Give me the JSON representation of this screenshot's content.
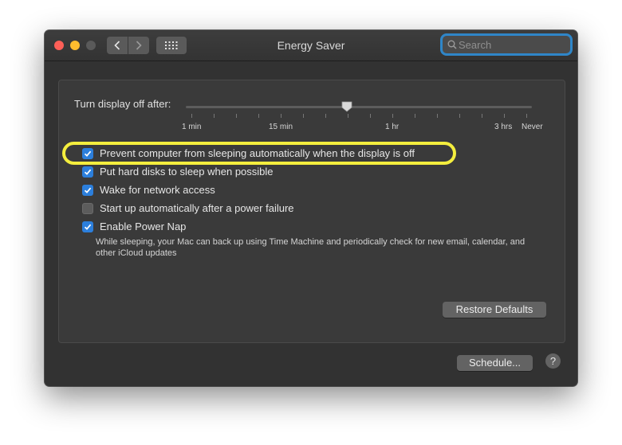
{
  "window": {
    "title": "Energy Saver"
  },
  "search": {
    "placeholder": "Search"
  },
  "slider": {
    "label": "Turn display off after:",
    "tick_labels": [
      "1 min",
      "15 min",
      "1 hr",
      "3 hrs",
      "Never"
    ],
    "value": "1 hr"
  },
  "options": [
    {
      "label": "Prevent computer from sleeping automatically when the display is off",
      "checked": true,
      "highlighted": true
    },
    {
      "label": "Put hard disks to sleep when possible",
      "checked": true
    },
    {
      "label": "Wake for network access",
      "checked": true
    },
    {
      "label": "Start up automatically after a power failure",
      "checked": false
    },
    {
      "label": "Enable Power Nap",
      "checked": true,
      "description": "While sleeping, your Mac can back up using Time Machine and periodically check for new email, calendar, and other iCloud updates"
    }
  ],
  "buttons": {
    "restore": "Restore Defaults",
    "schedule": "Schedule...",
    "help": "?"
  },
  "colors": {
    "accent": "#2c7fdc",
    "highlight": "#f4ee3e"
  },
  "icons": {
    "back": "chevron-left-icon",
    "forward": "chevron-right-icon",
    "show_all": "grid-icon",
    "search": "search-icon",
    "check": "checkmark-icon"
  }
}
